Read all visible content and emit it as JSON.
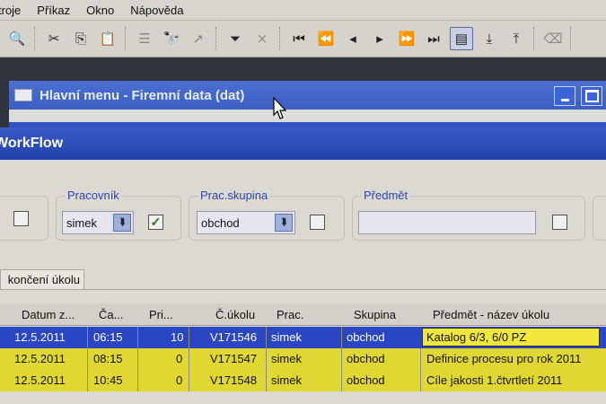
{
  "menubar": [
    "troje",
    "Příkaz",
    "Okno",
    "Nápověda"
  ],
  "toolbar": {
    "icons": [
      "preview-icon",
      "cut-icon",
      "copy-icon",
      "paste-icon",
      "properties-icon",
      "find-icon",
      "find-next-icon",
      "filter-icon",
      "filter-off-icon",
      "first-icon",
      "prev-page-icon",
      "prev-icon",
      "next-icon",
      "next-page-icon",
      "last-icon",
      "form-icon",
      "import-icon",
      "export-icon",
      "clear-icon"
    ]
  },
  "main_window": {
    "title": "Hlavní menu  -  Firemní data (dat)"
  },
  "workflow": {
    "title": "WorkFlow",
    "filters": {
      "worker_label": "Pracovník",
      "worker_value": "simek",
      "worker_checked": true,
      "group_label": "Prac.skupina",
      "group_value": "obchod",
      "group_checked": false,
      "subject_label": "Předmět",
      "subject_value": "",
      "subject_checked": false
    },
    "tab": "končení úkolu",
    "table": {
      "columns": [
        "Datum z...",
        "Ča...",
        "Pri...",
        "Č.úkolu",
        "Prac.",
        "Skupina",
        "Předmět - název úkolu"
      ],
      "rows": [
        {
          "date": "12.5.2011",
          "time": "06:15",
          "pri": "10",
          "id": "V171546",
          "worker": "simek",
          "group": "obchod",
          "subject": "Katalog 6/3, 6/0 PZ",
          "selected": true
        },
        {
          "date": "12.5.2011",
          "time": "08:15",
          "pri": "0",
          "id": "V171547",
          "worker": "simek",
          "group": "obchod",
          "subject": "Definice procesu pro rok 2011",
          "selected": false
        },
        {
          "date": "12.5.2011",
          "time": "10:45",
          "pri": "0",
          "id": "V171548",
          "worker": "simek",
          "group": "obchod",
          "subject": "Cíle jakosti 1.čtvrtletí 2011",
          "selected": false
        }
      ]
    }
  }
}
